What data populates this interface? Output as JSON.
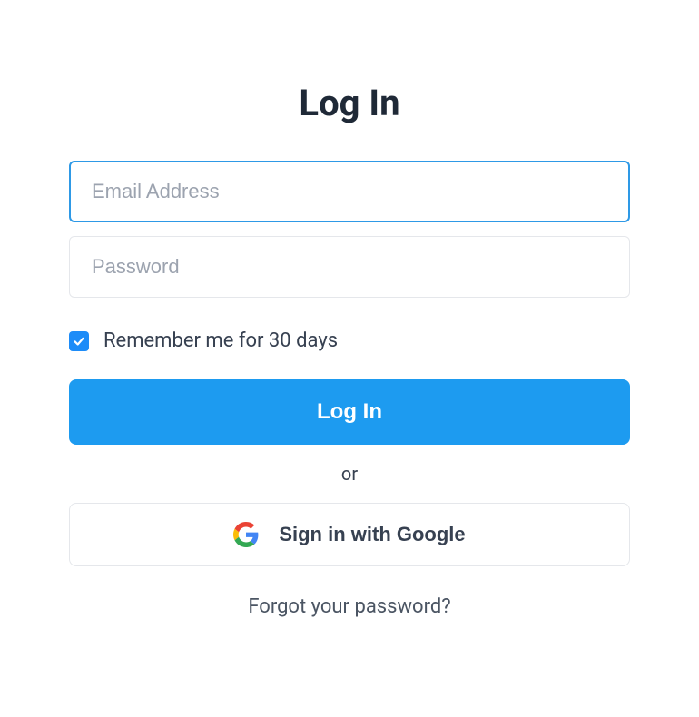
{
  "title": "Log In",
  "email": {
    "placeholder": "Email Address",
    "value": ""
  },
  "password": {
    "placeholder": "Password",
    "value": ""
  },
  "remember": {
    "label": "Remember me for 30 days",
    "checked": true
  },
  "login_button": "Log In",
  "or_text": "or",
  "google_button": "Sign in with Google",
  "forgot_link": "Forgot your password?"
}
